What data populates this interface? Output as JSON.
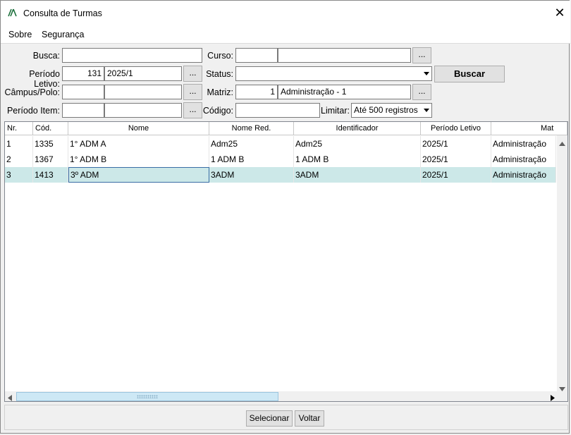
{
  "window": {
    "title": "Consulta de Turmas",
    "app_icon": "app-logo-icon",
    "close_glyph": "✕"
  },
  "menu": {
    "sobre": "Sobre",
    "seguranca": "Segurança"
  },
  "form": {
    "busca_label": "Busca:",
    "busca_value": "",
    "periodo_letivo_label": "Período Letivo:",
    "periodo_letivo_code": "131",
    "periodo_letivo_value": "2025/1",
    "campus_label": "Câmpus/Polo:",
    "campus_code": "",
    "campus_value": "",
    "periodo_item_label": "Período Item:",
    "periodo_item_code": "",
    "periodo_item_value": "",
    "curso_label": "Curso:",
    "curso_code": "",
    "curso_value": "",
    "status_label": "Status:",
    "status_value": "",
    "matriz_label": "Matriz:",
    "matriz_code": "1",
    "matriz_value": "Administração - 1",
    "codigo_label": "Código:",
    "codigo_value": "",
    "limitar_label": "Limitar:",
    "limitar_value": "Até 500 registros",
    "lookup_glyph": "...",
    "buscar_label": "Buscar"
  },
  "table": {
    "columns": [
      "Nr.",
      "Cód.",
      "Nome",
      "Nome Red.",
      "Identificador",
      "Período Letivo",
      "Mat"
    ],
    "rows": [
      [
        "1",
        "1335",
        "1° ADM A",
        "Adm25",
        "Adm25",
        "2025/1",
        "Administração"
      ],
      [
        "2",
        "1367",
        "1° ADM B",
        "1 ADM B",
        "1 ADM B",
        "2025/1",
        "Administração"
      ],
      [
        "3",
        "1413",
        "3º ADM",
        "3ADM",
        "3ADM",
        "2025/1",
        "Administração"
      ]
    ],
    "selected_row": 3,
    "highlight_color": "#cce8e8"
  },
  "footer": {
    "selecionar": "Selecionar",
    "voltar": "Voltar"
  }
}
